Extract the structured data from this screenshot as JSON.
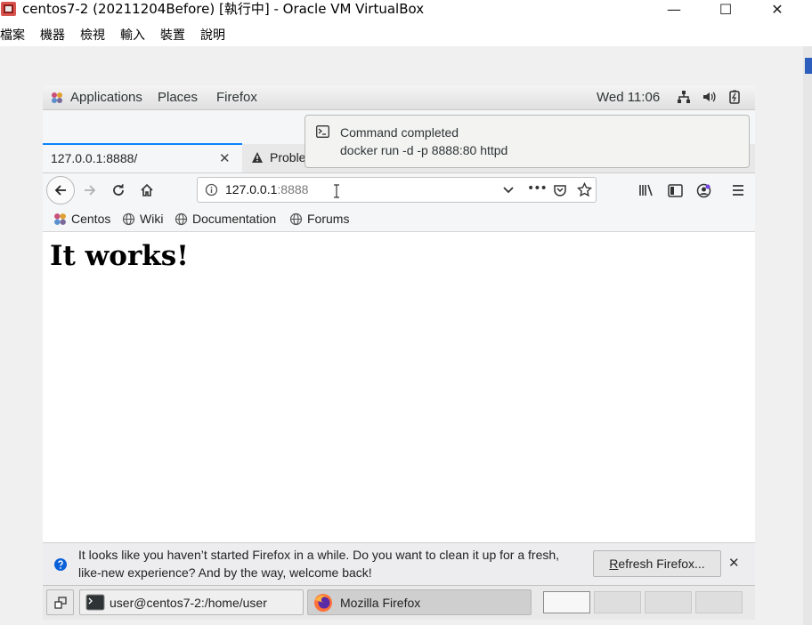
{
  "vbox": {
    "title": "centos7-2 (20211204Before) [執行中] - Oracle VM VirtualBox",
    "menu": [
      "檔案",
      "機器",
      "檢視",
      "輸入",
      "裝置",
      "說明"
    ],
    "minimize": "—",
    "maximize": "☐",
    "close": "✕"
  },
  "gnome": {
    "applications": "Applications",
    "places": "Places",
    "firefox": "Firefox",
    "clock": "Wed 11:06"
  },
  "notification": {
    "title": "Command completed",
    "body": "docker run -d -p 8888:80 httpd"
  },
  "tabs": [
    {
      "label": "127.0.0.1:8888/",
      "close": "✕"
    },
    {
      "label": "Proble"
    }
  ],
  "urlbar": {
    "host": "127.0.0.1",
    "port": ":8888",
    "more": "•••"
  },
  "bookmarks": [
    "Centos",
    "Wiki",
    "Documentation",
    "Forums"
  ],
  "page": {
    "heading": "It works!"
  },
  "infobar": {
    "line1": "It looks like you haven’t started Firefox in a while. Do you want to clean it up for a fresh,",
    "line2": "like-new experience? And by the way, welcome back!",
    "button_prefix": "R",
    "button_rest": "efresh Firefox...",
    "close": "✕"
  },
  "taskbar": {
    "terminal_task": "user@centos7-2:/home/user",
    "firefox_task": "Mozilla Firefox",
    "workspaces": 4,
    "active_workspace": 1
  },
  "colors": {
    "accent_tab": "#0a84ff",
    "vbox_icon": "#c0392b",
    "firefox_orange": "#ff7139"
  }
}
